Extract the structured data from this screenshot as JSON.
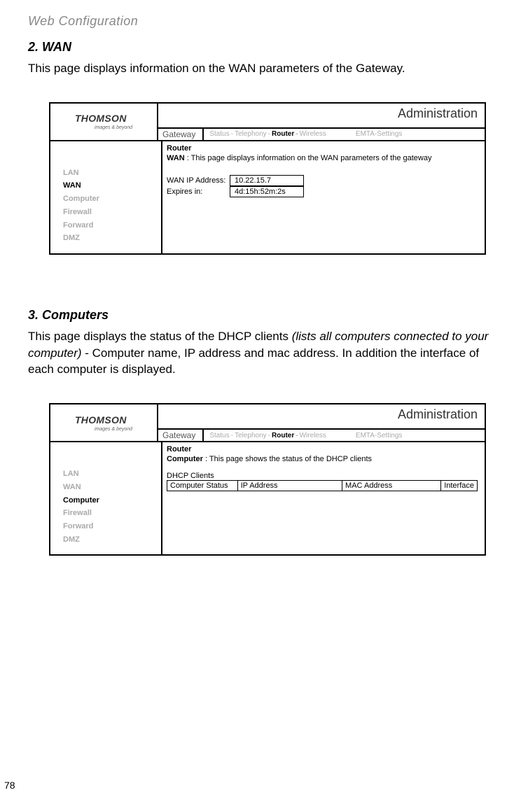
{
  "header": "Web Configuration",
  "pageNum": "78",
  "sections": {
    "wan": {
      "title": "2. WAN",
      "text": "This page displays information on the WAN parameters of the Gateway."
    },
    "computers": {
      "title": "3. Computers",
      "text1": "This page displays the status of the DHCP clients ",
      "textItalic": "(lists all computers connected to your computer)",
      "text2": " - Computer name, IP address and mac address. In addition the interface of each computer is displayed."
    }
  },
  "panel": {
    "adminTitle": "Administration",
    "gatewayLabel": "Gateway",
    "logo": {
      "brand": "THOMSON",
      "tag": "images & beyond"
    },
    "nav": {
      "status": "Status",
      "telephony": "Telephony",
      "router": "Router",
      "wireless": "Wireless",
      "emta": "EMTA-Settings",
      "dash": "-"
    },
    "sidebar": [
      "LAN",
      "WAN",
      "Computer",
      "Firewall",
      "Forward",
      "DMZ"
    ]
  },
  "wanContent": {
    "heading": "Router",
    "subBold": "WAN",
    "subText": " : This page displays information on the WAN parameters of the gateway",
    "rows": {
      "ipLabel": "WAN IP Address:",
      "ipValue": "10.22.15.7",
      "expLabel": "Expires in:",
      "expValue": "4d:15h:52m:2s"
    }
  },
  "compContent": {
    "heading": "Router",
    "subBold": "Computer",
    "subText": " : This page shows the status of the DHCP clients",
    "dhcpTitle": "DHCP Clients",
    "cols": [
      "Computer Status",
      "IP Address",
      "MAC Address",
      "Interface"
    ]
  }
}
